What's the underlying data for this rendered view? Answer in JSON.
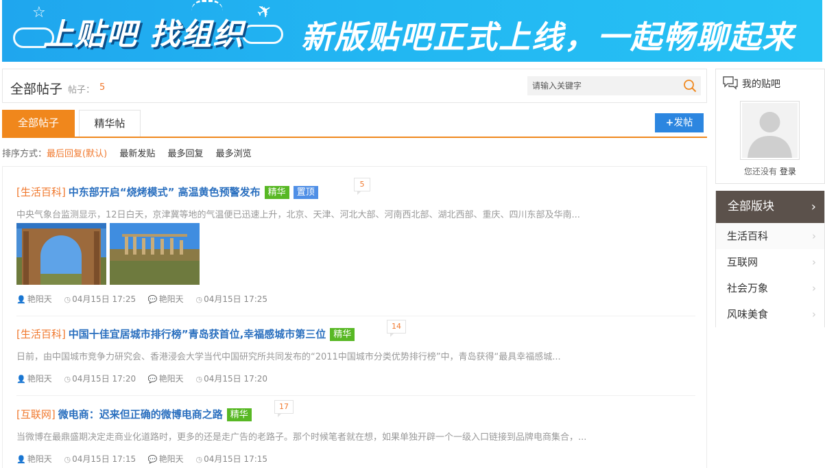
{
  "banner": {
    "left_text": "上贴吧 找组织",
    "right_text": "新版贴吧正式上线，一起畅聊起来"
  },
  "header": {
    "title": "全部帖子",
    "count_label": "帖子：",
    "count": "5",
    "search_placeholder": "请输入关键字"
  },
  "tabs": [
    {
      "label": "全部帖子",
      "active": true
    },
    {
      "label": "精华帖",
      "active": false
    }
  ],
  "post_button": "发帖",
  "sort": {
    "label": "排序方式：",
    "current": "最后回复(默认)",
    "options": [
      "最新发贴",
      "最多回复",
      "最多浏览"
    ]
  },
  "posts": [
    {
      "category": "[生活百科]",
      "title": "中东部开启“烧烤模式” 高温黄色预警发布",
      "badges": [
        "精华",
        "置顶"
      ],
      "replies": "5",
      "summary": "中央气象台监测显示，12日白天，京津冀等地的气温便已迅速上升，北京、天津、河北大部、河南西北部、湖北西部、重庆、四川东部及华南...",
      "author": "艳阳天",
      "time": "04月15日 17:25",
      "last_replier": "艳阳天",
      "last_time": "04月15日 17:25",
      "has_images": true
    },
    {
      "category": "[生活百科]",
      "title": "中国十佳宜居城市排行榜”青岛获首位,幸福感城市第三位",
      "badges": [
        "精华"
      ],
      "replies": "14",
      "summary": "日前，由中国城市竞争力研究会、香港浸会大学当代中国研究所共同发布的“2011中国城市分类优势排行榜”中，青岛获得“最具幸福感城...",
      "author": "艳阳天",
      "time": "04月15日 17:20",
      "last_replier": "艳阳天",
      "last_time": "04月15日 17:20",
      "has_images": false
    },
    {
      "category": "[互联网]",
      "title": "微电商：迟来但正确的微博电商之路",
      "badges": [
        "精华"
      ],
      "replies": "17",
      "summary": "当微博在最鼎盛期决定走商业化道路时，更多的还是走广告的老路子。那个时候笔者就在想，如果单独开辟一个一级入口链接到品牌电商集合，...",
      "author": "艳阳天",
      "time": "04月15日 17:15",
      "last_replier": "艳阳天",
      "last_time": "04月15日 17:15",
      "has_images": false
    }
  ],
  "sidebar": {
    "my_bar_title": "我的贴吧",
    "login_hint": "您还没有",
    "login_link": "登录",
    "boards_title": "全部版块",
    "boards": [
      "生活百科",
      "互联网",
      "社会万象",
      "风味美食"
    ]
  },
  "colors": {
    "accent_orange": "#f0871c",
    "link_blue": "#2a6fbf",
    "badge_green": "#58b824",
    "badge_blue": "#4f8fe6",
    "board_header": "#5b514b"
  }
}
